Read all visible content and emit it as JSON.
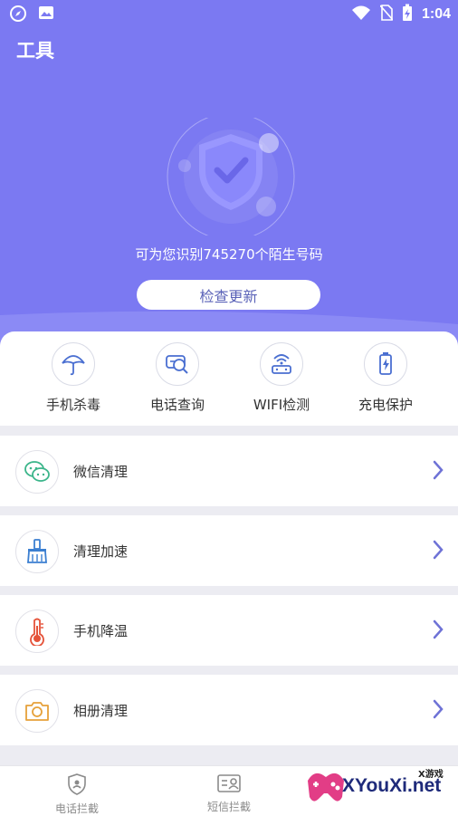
{
  "status_bar": {
    "time": "1:04",
    "icons": [
      "compass-icon",
      "image-icon",
      "wifi-icon",
      "no-sim-icon",
      "battery-charging-icon"
    ]
  },
  "header": {
    "title": "工具"
  },
  "hero": {
    "caption": "可为您识别745270个陌生号码",
    "update_button": "检查更新"
  },
  "tools": [
    {
      "label": "手机杀毒",
      "icon": "umbrella-icon"
    },
    {
      "label": "电话查询",
      "icon": "search-card-icon"
    },
    {
      "label": "WIFI检测",
      "icon": "wifi-router-icon"
    },
    {
      "label": "充电保护",
      "icon": "battery-bolt-icon"
    }
  ],
  "list": [
    {
      "label": "微信清理",
      "icon": "wechat-icon"
    },
    {
      "label": "清理加速",
      "icon": "broom-icon"
    },
    {
      "label": "手机降温",
      "icon": "thermometer-icon"
    },
    {
      "label": "相册清理",
      "icon": "camera-icon"
    }
  ],
  "bottom_nav": [
    {
      "label": "电话拦截",
      "icon": "shield-phone-icon"
    },
    {
      "label": "短信拦截",
      "icon": "contact-card-icon"
    }
  ],
  "watermark": {
    "text": "XYouXi.net",
    "small": "X游戏"
  },
  "colors": {
    "primary": "#7b79f2",
    "chevron": "#6e72d6",
    "accent_green": "#3bb58a",
    "accent_blue": "#3b7fd1",
    "accent_red": "#e5533a",
    "accent_orange": "#e6a13a"
  }
}
